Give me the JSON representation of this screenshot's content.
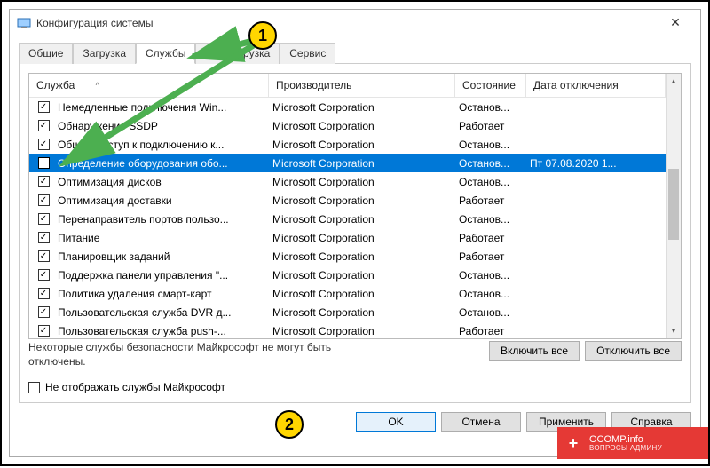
{
  "window": {
    "title": "Конфигурация системы"
  },
  "tabs": {
    "general": "Общие",
    "boot": "Загрузка",
    "services": "Службы",
    "startup": "Автозагрузка",
    "tools": "Сервис"
  },
  "columns": {
    "service": "Служба",
    "manufacturer": "Производитель",
    "state": "Состояние",
    "disable_date": "Дата отключения"
  },
  "services": [
    {
      "checked": true,
      "name": "Немедленные подключения Win...",
      "manufacturer": "Microsoft Corporation",
      "state": "Останов...",
      "date": ""
    },
    {
      "checked": true,
      "name": "Обнаружение SSDP",
      "manufacturer": "Microsoft Corporation",
      "state": "Работает",
      "date": ""
    },
    {
      "checked": true,
      "name": "Общий доступ к подключению к...",
      "manufacturer": "Microsoft Corporation",
      "state": "Останов...",
      "date": ""
    },
    {
      "checked": false,
      "name": "Определение оборудования обо...",
      "manufacturer": "Microsoft Corporation",
      "state": "Останов...",
      "date": "Пт 07.08.2020 1...",
      "selected": true
    },
    {
      "checked": true,
      "name": "Оптимизация дисков",
      "manufacturer": "Microsoft Corporation",
      "state": "Останов...",
      "date": ""
    },
    {
      "checked": true,
      "name": "Оптимизация доставки",
      "manufacturer": "Microsoft Corporation",
      "state": "Работает",
      "date": ""
    },
    {
      "checked": true,
      "name": "Перенаправитель портов пользо...",
      "manufacturer": "Microsoft Corporation",
      "state": "Останов...",
      "date": ""
    },
    {
      "checked": true,
      "name": "Питание",
      "manufacturer": "Microsoft Corporation",
      "state": "Работает",
      "date": ""
    },
    {
      "checked": true,
      "name": "Планировщик заданий",
      "manufacturer": "Microsoft Corporation",
      "state": "Работает",
      "date": ""
    },
    {
      "checked": true,
      "name": "Поддержка панели управления \"...",
      "manufacturer": "Microsoft Corporation",
      "state": "Останов...",
      "date": ""
    },
    {
      "checked": true,
      "name": "Политика удаления смарт-карт",
      "manufacturer": "Microsoft Corporation",
      "state": "Останов...",
      "date": ""
    },
    {
      "checked": true,
      "name": "Пользовательская служба DVR д...",
      "manufacturer": "Microsoft Corporation",
      "state": "Останов...",
      "date": ""
    },
    {
      "checked": true,
      "name": "Пользовательская служба push-...",
      "manufacturer": "Microsoft Corporation",
      "state": "Работает",
      "date": ""
    }
  ],
  "note_text": "Некоторые службы безопасности Майкрософт не могут быть отключены.",
  "buttons": {
    "enable_all": "Включить все",
    "disable_all": "Отключить все",
    "hide_ms": "Не отображать службы Майкрософт",
    "ok": "OK",
    "cancel": "Отмена",
    "apply": "Применить",
    "help": "Справка"
  },
  "annotations": {
    "marker1": "1",
    "marker2": "2"
  },
  "watermark": {
    "domain": "OCOMP.info",
    "sub": "ВОПРОСЫ АДМИНУ"
  }
}
